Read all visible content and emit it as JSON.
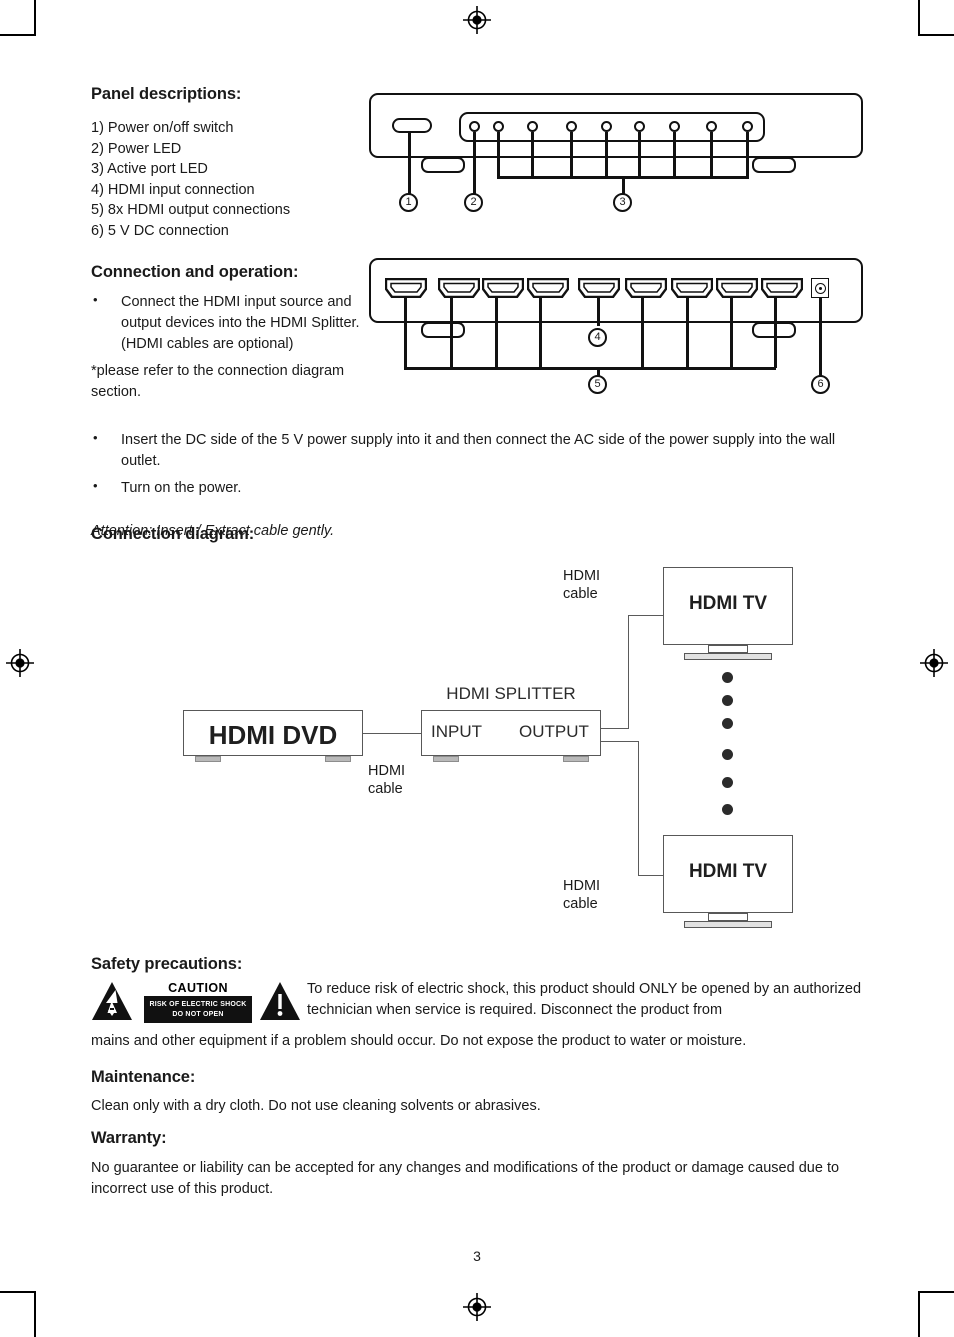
{
  "page": {
    "number": "3"
  },
  "panel_descriptions": {
    "heading": "Panel descriptions:",
    "items": [
      "1) Power on/off switch",
      "2) Power LED",
      "3) Active port LED",
      "4) HDMI input connection",
      "5) 8x HDMI output connections",
      "6) 5 V DC connection"
    ]
  },
  "front_panel": {
    "callouts": [
      "1",
      "2",
      "3"
    ],
    "led_count": 9
  },
  "rear_panel": {
    "callouts": [
      "4",
      "5",
      "6"
    ],
    "hdmi_port_count": 9
  },
  "connection_and_operation": {
    "heading": "Connection and operation:",
    "bullet_1": "Connect the HDMI input source and output devices into the HDMI Splitter. (HDMI cables are optional)",
    "note": "*please refer to the connection diagram section.",
    "bullet_2": "Insert the DC side of the 5 V power supply into it and then connect the AC side of the power supply into the wall outlet.",
    "bullet_3": "Turn on the power.",
    "attention": "Attention: Insert / Extract cable gently."
  },
  "connection_diagram": {
    "heading": "Connection diagram:",
    "source_label": "HDMI DVD",
    "splitter_title": "HDMI SPLITTER",
    "splitter_input": "INPUT",
    "splitter_output": "OUTPUT",
    "tv_label_top": "HDMI TV",
    "tv_label_bottom": "HDMI TV",
    "cable_label_top": "HDMI\ncable",
    "cable_label_input": "HDMI\ncable",
    "cable_label_bottom": "HDMI\ncable",
    "cable_label_line1": "HDMI",
    "cable_label_line2": "cable",
    "ellipsis_dots": 6
  },
  "safety": {
    "heading": "Safety precautions:",
    "caution_title": "CAUTION",
    "caution_line1": "RISK OF ELECTRIC SHOCK",
    "caution_line2": "DO NOT OPEN",
    "text_part1": "To reduce risk of electric shock, this product should ONLY be opened by an authorized technician when service is required. Disconnect the product from",
    "text_part2": "mains and other equipment if a problem should occur. Do not expose the product to water or moisture."
  },
  "maintenance": {
    "heading": "Maintenance:",
    "text": "Clean only with a dry cloth. Do not use cleaning solvents or abrasives."
  },
  "warranty": {
    "heading": "Warranty:",
    "text": "No guarantee or liability can be accepted for any changes and modifications of the product or damage caused due to incorrect use of this product."
  },
  "colors": {
    "ink": "#1a1a1a",
    "line": "#585858",
    "caution_bg": "#111111"
  }
}
